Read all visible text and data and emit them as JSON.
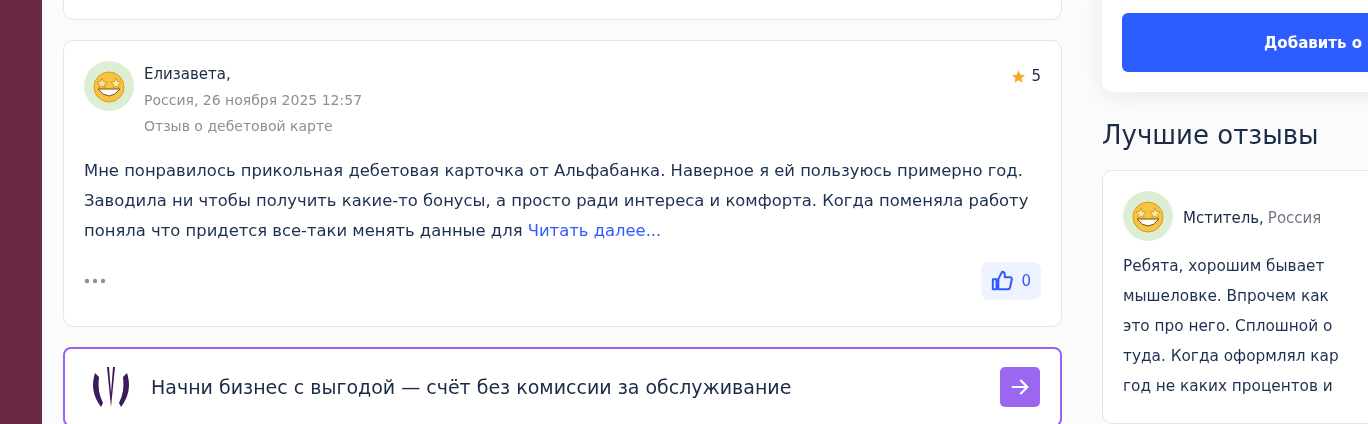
{
  "review": {
    "author": "Елизавета,",
    "meta": "Россия, 26 ноября 2025 12:57",
    "subject": "Отзыв о дебетовой карте",
    "rating": "5",
    "body": "Мне понравилось прикольная дебетовая карточка от Альфабанка. Наверное я ей пользуюсь примерно год. Заводила ни чтобы получить какие-то бонусы, а просто ради интереса и комфорта. Когда поменяла работу поняла что придется все-таки менять данные для",
    "read_more": "Читать далее...",
    "likes": "0"
  },
  "ad": {
    "text": "Начни бизнес с выгодой — счёт без комиссии за обслуживание"
  },
  "sidebar": {
    "add_button": "Добавить о",
    "best_title": "Лучшие отзывы",
    "best_review": {
      "author": "Мститель,",
      "location": "Россия",
      "lines": [
        "Ребята, хорошим бывает",
        "мышеловке. Впрочем как",
        "это про него. Сплошной о",
        "туда. Когда оформлял кар",
        "год не каких процентов и"
      ]
    }
  }
}
